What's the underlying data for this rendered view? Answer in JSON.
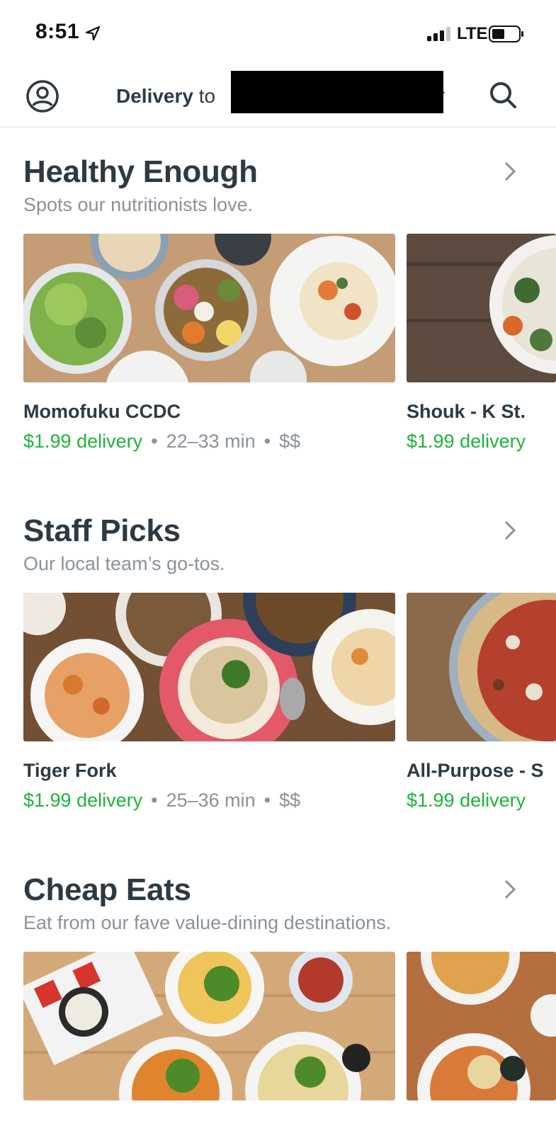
{
  "status": {
    "time": "8:51",
    "carrier": "LTE"
  },
  "header": {
    "delivery_bold": "Delivery",
    "delivery_to": "to"
  },
  "sections": [
    {
      "title": "Healthy Enough",
      "subtitle": "Spots our nutritionists love.",
      "cards": [
        {
          "name": "Momofuku CCDC",
          "fee": "$1.99 delivery",
          "time": "22–33 min",
          "price": "$$"
        },
        {
          "name": "Shouk -  K St.",
          "fee": "$1.99 delivery"
        }
      ]
    },
    {
      "title": "Staff Picks",
      "subtitle": "Our local team’s go-tos.",
      "cards": [
        {
          "name": "Tiger Fork",
          "fee": "$1.99 delivery",
          "time": "25–36 min",
          "price": "$$"
        },
        {
          "name": "All-Purpose - S",
          "fee": "$1.99 delivery"
        }
      ]
    },
    {
      "title": "Cheap Eats",
      "subtitle": "Eat from our fave value-dining destinations."
    }
  ],
  "separator": "•"
}
